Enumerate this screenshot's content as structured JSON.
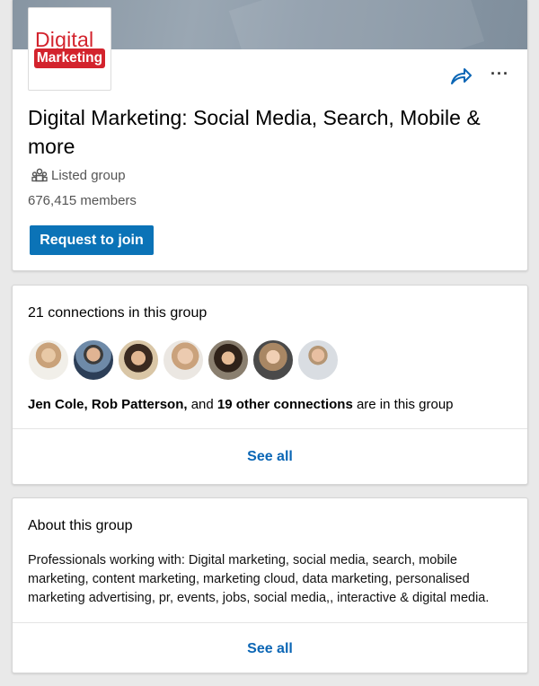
{
  "colors": {
    "brand_red": "#d3232d",
    "primary_button": "#0b73b7",
    "link_blue": "#0b66b5",
    "page_background": "#e9e9e9"
  },
  "header": {
    "logo": {
      "line1": "Digital",
      "line2": "Marketing"
    },
    "share_icon": "share-arrow-icon",
    "more_icon": "more-dots-icon",
    "more_label": "···",
    "title": "Digital Marketing: Social Media, Search, Mobile & more",
    "visibility_icon": "group-people-icon",
    "visibility": "Listed group",
    "members": "676,415 members",
    "join_button": "Request to join"
  },
  "connections": {
    "title": "21 connections in this group",
    "avatars": [
      {
        "name": "connection-1"
      },
      {
        "name": "connection-2"
      },
      {
        "name": "connection-3"
      },
      {
        "name": "connection-4"
      },
      {
        "name": "connection-5"
      },
      {
        "name": "connection-6"
      },
      {
        "name": "connection-7"
      }
    ],
    "names_part1": "Jen Cole, Rob Patterson,",
    "and_text": " and ",
    "names_part2": "19 other connections",
    "suffix": " are in this group",
    "see_all": "See all"
  },
  "about": {
    "title": "About this group",
    "description": "Professionals working with: Digital marketing, social media, search,  mobile marketing, content marketing, marketing cloud, data marketing,  personalised marketing advertising, pr, events, jobs, social media,, interactive & digital media.",
    "see_all": "See all"
  }
}
